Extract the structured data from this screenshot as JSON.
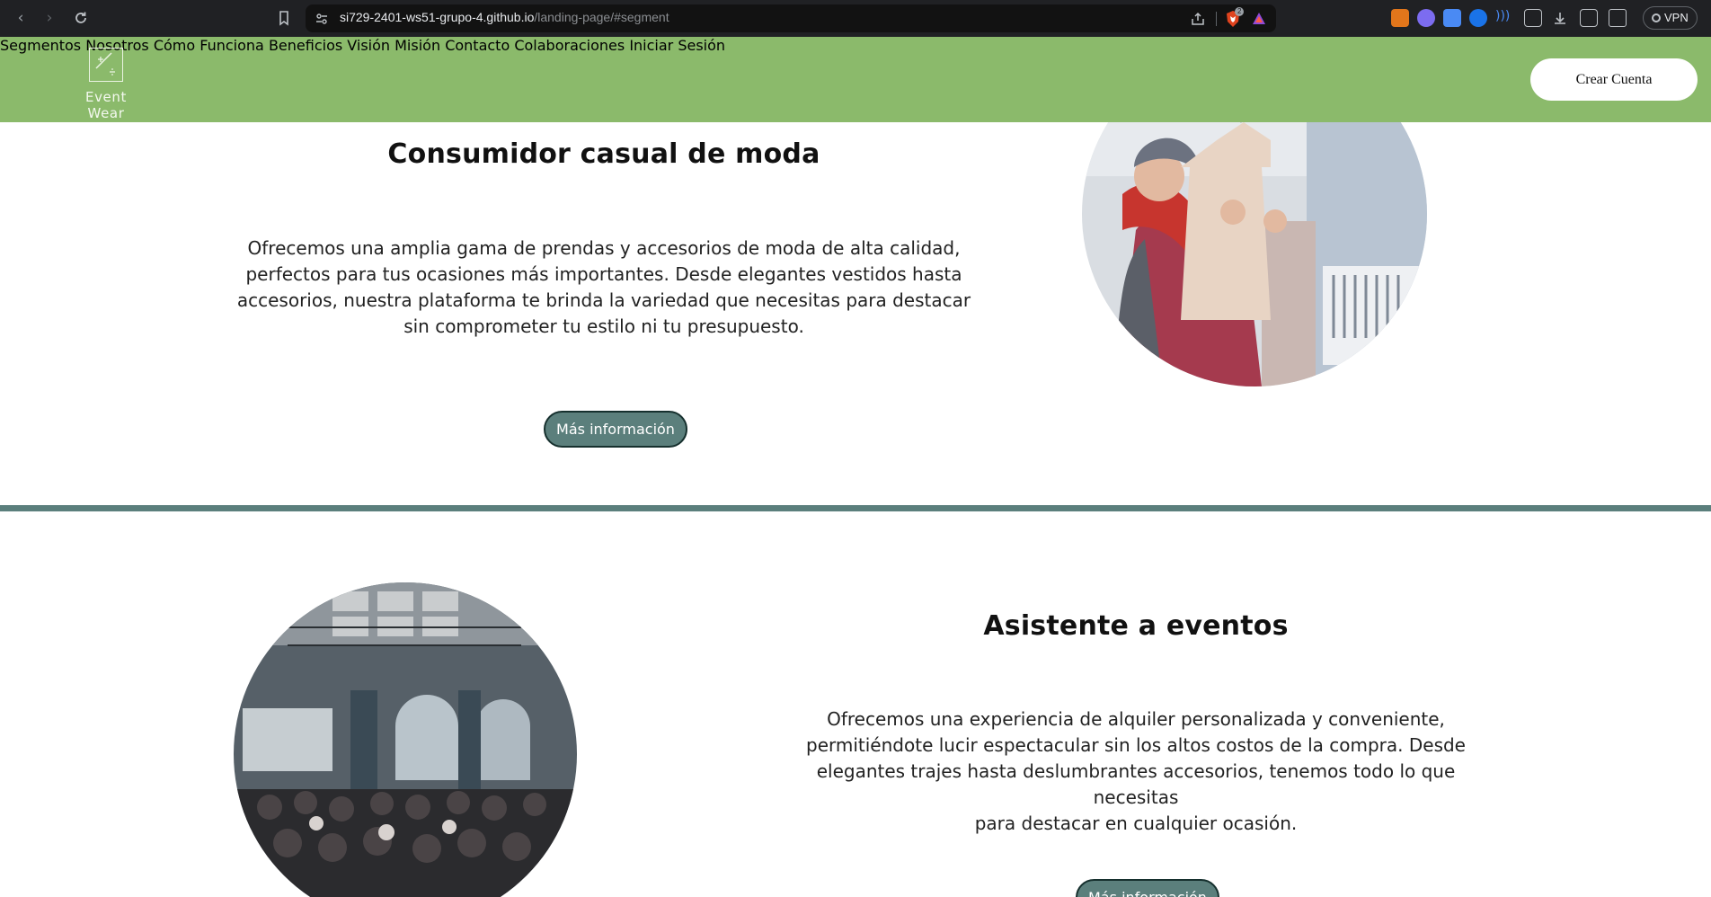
{
  "browser": {
    "url_host": "si729-2401-ws51-grupo-4.github.io",
    "url_path": "/landing-page/#segment",
    "brave_badge": "2",
    "vpn_label": "VPN"
  },
  "site": {
    "logo_text": "Event Wear",
    "nav": [
      "Segmentos",
      "Nosotros",
      "Cómo Funciona",
      "Beneficios",
      "Visión",
      "Misión",
      "Contacto",
      "Colaboraciones",
      "Iniciar Sesión"
    ],
    "cta_label": "Crear Cuenta",
    "brand_green": "#8bba6b",
    "accent_teal": "#5b7f7c"
  },
  "segments": [
    {
      "title": "Consumidor casual de moda",
      "lines": [
        "Ofrecemos una amplia gama de prendas y accesorios de moda de alta calidad,",
        "perfectos para tus ocasiones más importantes. Desde elegantes vestidos hasta",
        "accesorios, nuestra plataforma te brinda la variedad que necesitas para destacar",
        "sin comprometer tu estilo ni tu presupuesto."
      ],
      "button": "Más información"
    },
    {
      "title": "Asistente a eventos",
      "lines": [
        "Ofrecemos una experiencia de alquiler personalizada y conveniente,",
        "permitiéndote lucir espectacular sin los altos costos de la compra. Desde",
        "elegantes trajes hasta deslumbrantes accesorios, tenemos todo lo que necesitas",
        "para destacar en cualquier ocasión."
      ],
      "button": "Más información"
    }
  ]
}
